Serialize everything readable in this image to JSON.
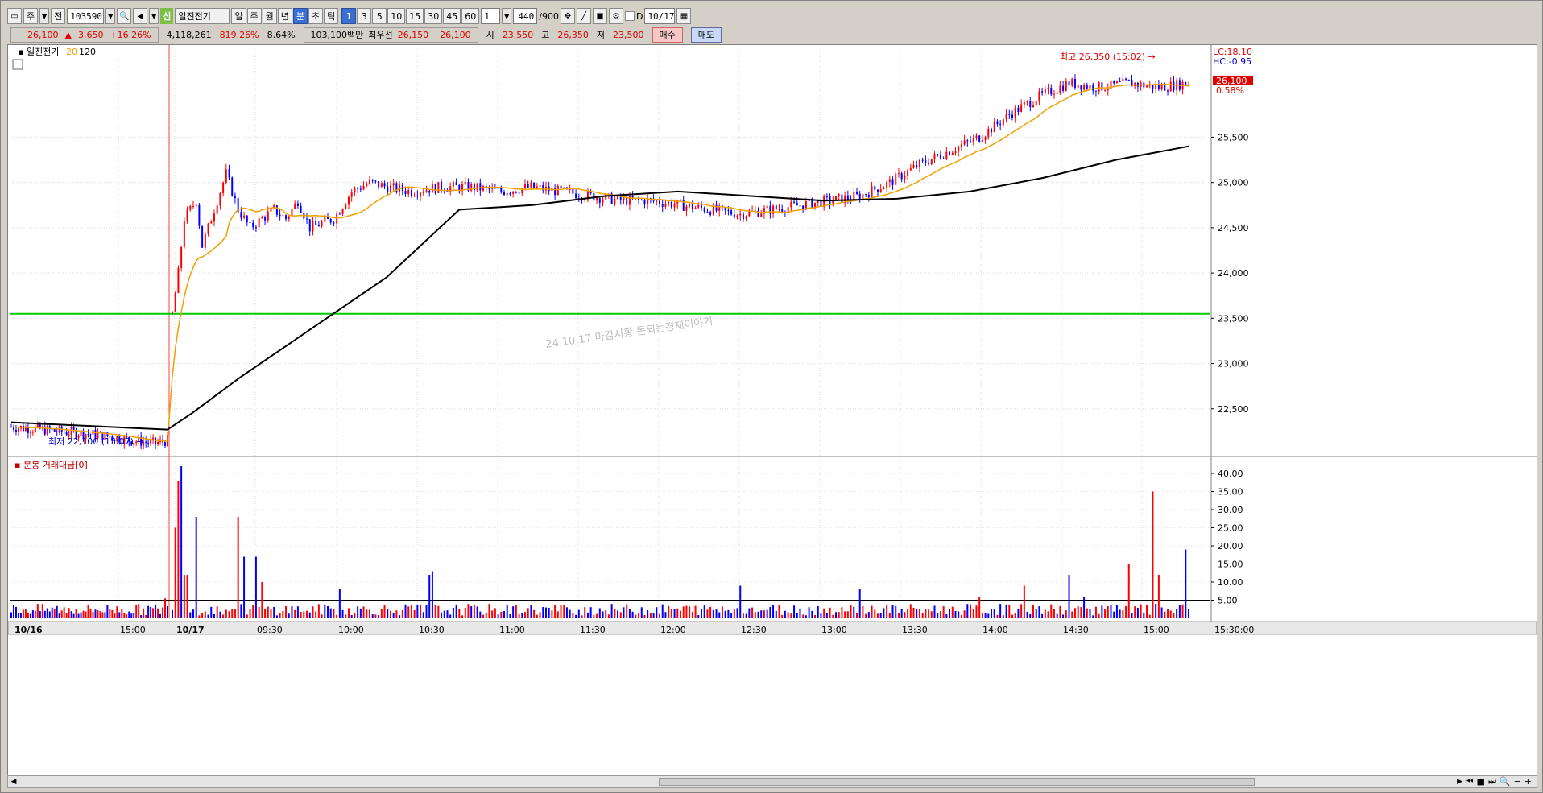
{
  "toolbar": {
    "period_label": "주",
    "period2_label": "전",
    "code": "103590",
    "new_tag": "신",
    "stock_name": "일진전기",
    "freq_buttons": [
      "일",
      "주",
      "월",
      "년",
      "분",
      "초",
      "틱"
    ],
    "interval_buttons": [
      "1",
      "3",
      "5",
      "10",
      "15",
      "30",
      "45",
      "60"
    ],
    "interval_value": "1",
    "count_value": "440",
    "count_max": "/900",
    "d_label": "D",
    "date_value": "10/17"
  },
  "quote": {
    "price": "26,100",
    "change": "3,650",
    "change_pct": "+16.26%",
    "volume": "4,118,261",
    "volume_ratio": "819.26%",
    "turnover": "8.64%",
    "amount": "103,100백만",
    "best_label": "최우선",
    "best_ask": "26,150",
    "best_bid": "26,100",
    "open_label": "시",
    "open": "23,550",
    "high_label": "고",
    "high": "26,350",
    "low_label": "저",
    "low": "23,500",
    "buy_label": "매수",
    "sell_label": "매도"
  },
  "chart_data": {
    "type": "candlestick",
    "legend": {
      "name": "일진전기",
      "ma_short": "20",
      "ma_long": "120"
    },
    "lc_label": "LC:18.10",
    "hc_label": "HC:-0.95",
    "last_price_label": "26,100",
    "last_pct_label": "0.58%",
    "high_annotation": "최고 26,350 (15:02)",
    "low_annotation": "최저 22,100 (15:07)",
    "watermark": "24.10.17 마감시황 돈되는경제이야기",
    "price_axis": [
      "25,500",
      "25,000",
      "24,500",
      "24,000",
      "23,500",
      "23,000",
      "22,500"
    ],
    "price_axis_values": [
      25500,
      25000,
      24500,
      24000,
      23500,
      23000,
      22500
    ],
    "ylim": [
      22000,
      26500
    ],
    "reference_line": 23550,
    "colors": {
      "up": "#ff0000",
      "down": "#0000ff",
      "ma_short": "#f0a000",
      "ma_long": "#000000",
      "reference": "#00cc00"
    },
    "volume_panel_title": "분봉 거래대금[0]",
    "volume_axis": [
      "40.00",
      "35.00",
      "30.00",
      "25.00",
      "20.00",
      "15.00",
      "10.00",
      "5.00"
    ],
    "volume_axis_values": [
      40,
      35,
      30,
      25,
      20,
      15,
      10,
      5
    ],
    "volume_ylim": [
      0,
      44
    ],
    "volume_reference": 5,
    "x_axis_labels": [
      "10/16",
      "15:00",
      "10/17",
      "09:30",
      "10:00",
      "10:30",
      "11:00",
      "11:30",
      "12:00",
      "12:30",
      "13:00",
      "13:30",
      "14:00",
      "14:30",
      "15:00",
      "15:30:00"
    ],
    "price_series": {
      "prev_day": [
        [
          0,
          22300
        ],
        [
          10,
          22280
        ],
        [
          20,
          22250
        ],
        [
          30,
          22230
        ],
        [
          40,
          22200
        ],
        [
          50,
          22150
        ],
        [
          60,
          22120
        ],
        [
          65,
          22150
        ]
      ],
      "today": [
        [
          0,
          23550
        ],
        [
          2,
          24000
        ],
        [
          4,
          24600
        ],
        [
          8,
          24800
        ],
        [
          10,
          24300
        ],
        [
          14,
          24700
        ],
        [
          18,
          25100
        ],
        [
          22,
          24700
        ],
        [
          26,
          24500
        ],
        [
          30,
          24600
        ],
        [
          34,
          24700
        ],
        [
          38,
          24600
        ],
        [
          42,
          24800
        ],
        [
          46,
          24500
        ],
        [
          50,
          24550
        ],
        [
          54,
          24600
        ],
        [
          60,
          24900
        ],
        [
          66,
          25000
        ],
        [
          72,
          24950
        ],
        [
          80,
          24900
        ],
        [
          90,
          24950
        ],
        [
          100,
          24950
        ],
        [
          110,
          24900
        ],
        [
          120,
          24950
        ],
        [
          130,
          24900
        ],
        [
          140,
          24850
        ],
        [
          150,
          24800
        ],
        [
          160,
          24800
        ],
        [
          170,
          24750
        ],
        [
          180,
          24700
        ],
        [
          190,
          24650
        ],
        [
          200,
          24700
        ],
        [
          210,
          24750
        ],
        [
          220,
          24800
        ],
        [
          230,
          24850
        ],
        [
          240,
          25000
        ],
        [
          250,
          25200
        ],
        [
          260,
          25350
        ],
        [
          270,
          25500
        ],
        [
          280,
          25750
        ],
        [
          290,
          25950
        ],
        [
          300,
          26100
        ],
        [
          310,
          26050
        ],
        [
          320,
          26100
        ],
        [
          330,
          26050
        ],
        [
          340,
          26100
        ]
      ]
    },
    "ma_long_series": {
      "prev_day": [
        [
          0,
          22350
        ],
        [
          65,
          22270
        ]
      ],
      "today": [
        [
          0,
          22270
        ],
        [
          10,
          22450
        ],
        [
          30,
          22850
        ],
        [
          60,
          23400
        ],
        [
          90,
          23950
        ],
        [
          120,
          24700
        ],
        [
          150,
          24750
        ],
        [
          180,
          24850
        ],
        [
          210,
          24900
        ],
        [
          240,
          24850
        ],
        [
          270,
          24800
        ],
        [
          300,
          24820
        ],
        [
          330,
          24900
        ],
        [
          360,
          25050
        ],
        [
          390,
          25250
        ],
        [
          420,
          25400
        ]
      ]
    }
  }
}
